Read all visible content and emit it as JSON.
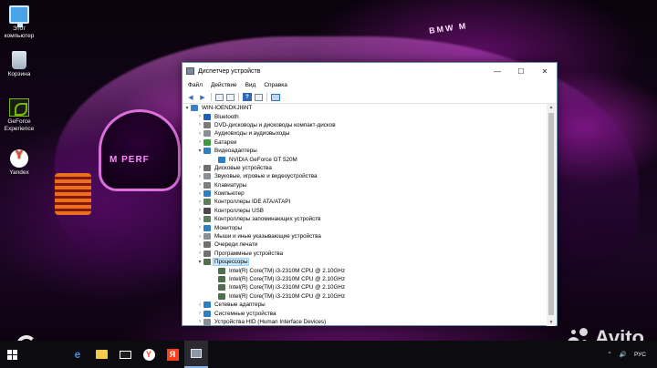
{
  "desktop": {
    "icons": [
      {
        "label": "Этот компьютер"
      },
      {
        "label": "Корзина"
      },
      {
        "label": "GeForce Experience"
      },
      {
        "label": "Yandex"
      }
    ]
  },
  "window": {
    "title": "Диспетчер устройств",
    "menu": [
      "Файл",
      "Действие",
      "Вид",
      "Справка"
    ],
    "tree": {
      "root": "WIN-IOENDKJI6NT",
      "items": [
        {
          "label": "Bluetooth",
          "level": 1,
          "expanded": false,
          "icon": "bluetooth-icon",
          "color": "#1f5fb8"
        },
        {
          "label": "DVD-дисководы и дисководы компакт-дисков",
          "level": 1,
          "expanded": false,
          "icon": "dvd-drive-icon",
          "color": "#7a7a7a"
        },
        {
          "label": "Аудиовходы и аудиовыходы",
          "level": 1,
          "expanded": false,
          "icon": "audio-icon",
          "color": "#8a8f96"
        },
        {
          "label": "Батареи",
          "level": 1,
          "expanded": false,
          "icon": "battery-icon",
          "color": "#3f9a3f"
        },
        {
          "label": "Видеоадаптеры",
          "level": 1,
          "expanded": true,
          "icon": "display-adapter-icon",
          "color": "#2e7fc2"
        },
        {
          "label": "NVIDIA GeForce GT 520M",
          "level": 2,
          "icon": "display-adapter-icon",
          "color": "#2e7fc2"
        },
        {
          "label": "Дисковые устройства",
          "level": 1,
          "expanded": false,
          "icon": "disk-icon",
          "color": "#6f6f6f"
        },
        {
          "label": "Звуковые, игровые и видеоустройства",
          "level": 1,
          "expanded": false,
          "icon": "sound-icon",
          "color": "#8a8f96"
        },
        {
          "label": "Клавиатуры",
          "level": 1,
          "expanded": false,
          "icon": "keyboard-icon",
          "color": "#7d7d7d"
        },
        {
          "label": "Компьютер",
          "level": 1,
          "expanded": false,
          "icon": "computer-icon",
          "color": "#2e7fc2"
        },
        {
          "label": "Контроллеры IDE ATA/ATAPI",
          "level": 1,
          "expanded": false,
          "icon": "ide-controller-icon",
          "color": "#5d7d5d"
        },
        {
          "label": "Контроллеры USB",
          "level": 1,
          "expanded": false,
          "icon": "usb-icon",
          "color": "#4a4a4a"
        },
        {
          "label": "Контроллеры запоминающих устройств",
          "level": 1,
          "expanded": false,
          "icon": "storage-controller-icon",
          "color": "#5d7d5d"
        },
        {
          "label": "Мониторы",
          "level": 1,
          "expanded": false,
          "icon": "monitor-icon",
          "color": "#2e7fc2"
        },
        {
          "label": "Мыши и иные указывающие устройства",
          "level": 1,
          "expanded": false,
          "icon": "mouse-icon",
          "color": "#8a8f96"
        },
        {
          "label": "Очереди печати",
          "level": 1,
          "expanded": false,
          "icon": "printer-icon",
          "color": "#6f6f6f"
        },
        {
          "label": "Программные устройства",
          "level": 1,
          "expanded": false,
          "icon": "software-device-icon",
          "color": "#6f6f6f"
        },
        {
          "label": "Процессоры",
          "level": 1,
          "expanded": true,
          "icon": "processor-icon",
          "color": "#4f6f4f",
          "selected": true
        },
        {
          "label": "Intel(R) Core(TM) i3-2310M CPU @ 2.10GHz",
          "level": 2,
          "icon": "processor-icon",
          "color": "#4f6f4f"
        },
        {
          "label": "Intel(R) Core(TM) i3-2310M CPU @ 2.10GHz",
          "level": 2,
          "icon": "processor-icon",
          "color": "#4f6f4f"
        },
        {
          "label": "Intel(R) Core(TM) i3-2310M CPU @ 2.10GHz",
          "level": 2,
          "icon": "processor-icon",
          "color": "#4f6f4f"
        },
        {
          "label": "Intel(R) Core(TM) i3-2310M CPU @ 2.10GHz",
          "level": 2,
          "icon": "processor-icon",
          "color": "#4f6f4f"
        },
        {
          "label": "Сетевые адаптеры",
          "level": 1,
          "expanded": false,
          "icon": "network-adapter-icon",
          "color": "#2e7fc2"
        },
        {
          "label": "Системные устройства",
          "level": 1,
          "expanded": false,
          "icon": "system-device-icon",
          "color": "#2e7fc2"
        },
        {
          "label": "Устройства HID (Human Interface Devices)",
          "level": 1,
          "expanded": false,
          "icon": "hid-icon",
          "color": "#8a8f96"
        }
      ]
    }
  },
  "taskbar": {
    "items": [
      "start",
      "search",
      "task-view",
      "file-explorer",
      "mail",
      "yandex-browser",
      "yandex-app",
      "device-manager"
    ],
    "tray": {
      "language": "РУС"
    }
  },
  "watermark": {
    "text": "Avito"
  },
  "wallpaper": {
    "texts": [
      "M PERF",
      "BMW M"
    ]
  }
}
